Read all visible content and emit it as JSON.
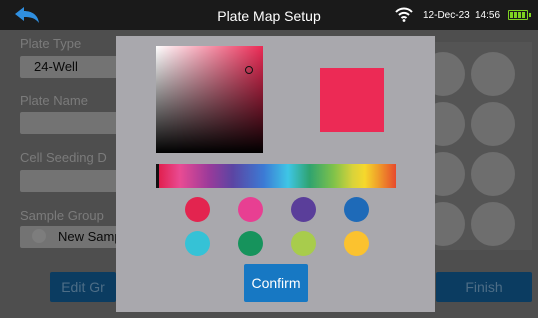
{
  "status_bar": {
    "title": "Plate Map Setup",
    "date": "12-Dec-23",
    "time": "14:56"
  },
  "form": {
    "plate_type_label": "Plate Type",
    "plate_type_value": "24-Well",
    "plate_name_label": "Plate Name",
    "plate_name_value": "",
    "cell_seeding_label": "Cell Seeding D",
    "cell_seeding_value": "",
    "sample_group_label": "Sample Group",
    "sample_group_value": "New Samp"
  },
  "buttons": {
    "edit_label": "Edit Gr",
    "finish_label": "Finish"
  },
  "color_picker": {
    "selected_color": "#ec2a55",
    "swatches": [
      {
        "name": "red",
        "color": "#e3244f"
      },
      {
        "name": "pink",
        "color": "#e83f92"
      },
      {
        "name": "purple",
        "color": "#5a3e9a"
      },
      {
        "name": "blue",
        "color": "#1e6ab8"
      },
      {
        "name": "cyan",
        "color": "#35c2d6"
      },
      {
        "name": "green",
        "color": "#16935c"
      },
      {
        "name": "lime",
        "color": "#a8cc4c"
      },
      {
        "name": "yellow",
        "color": "#fbc22f"
      }
    ],
    "confirm_label": "Confirm"
  }
}
